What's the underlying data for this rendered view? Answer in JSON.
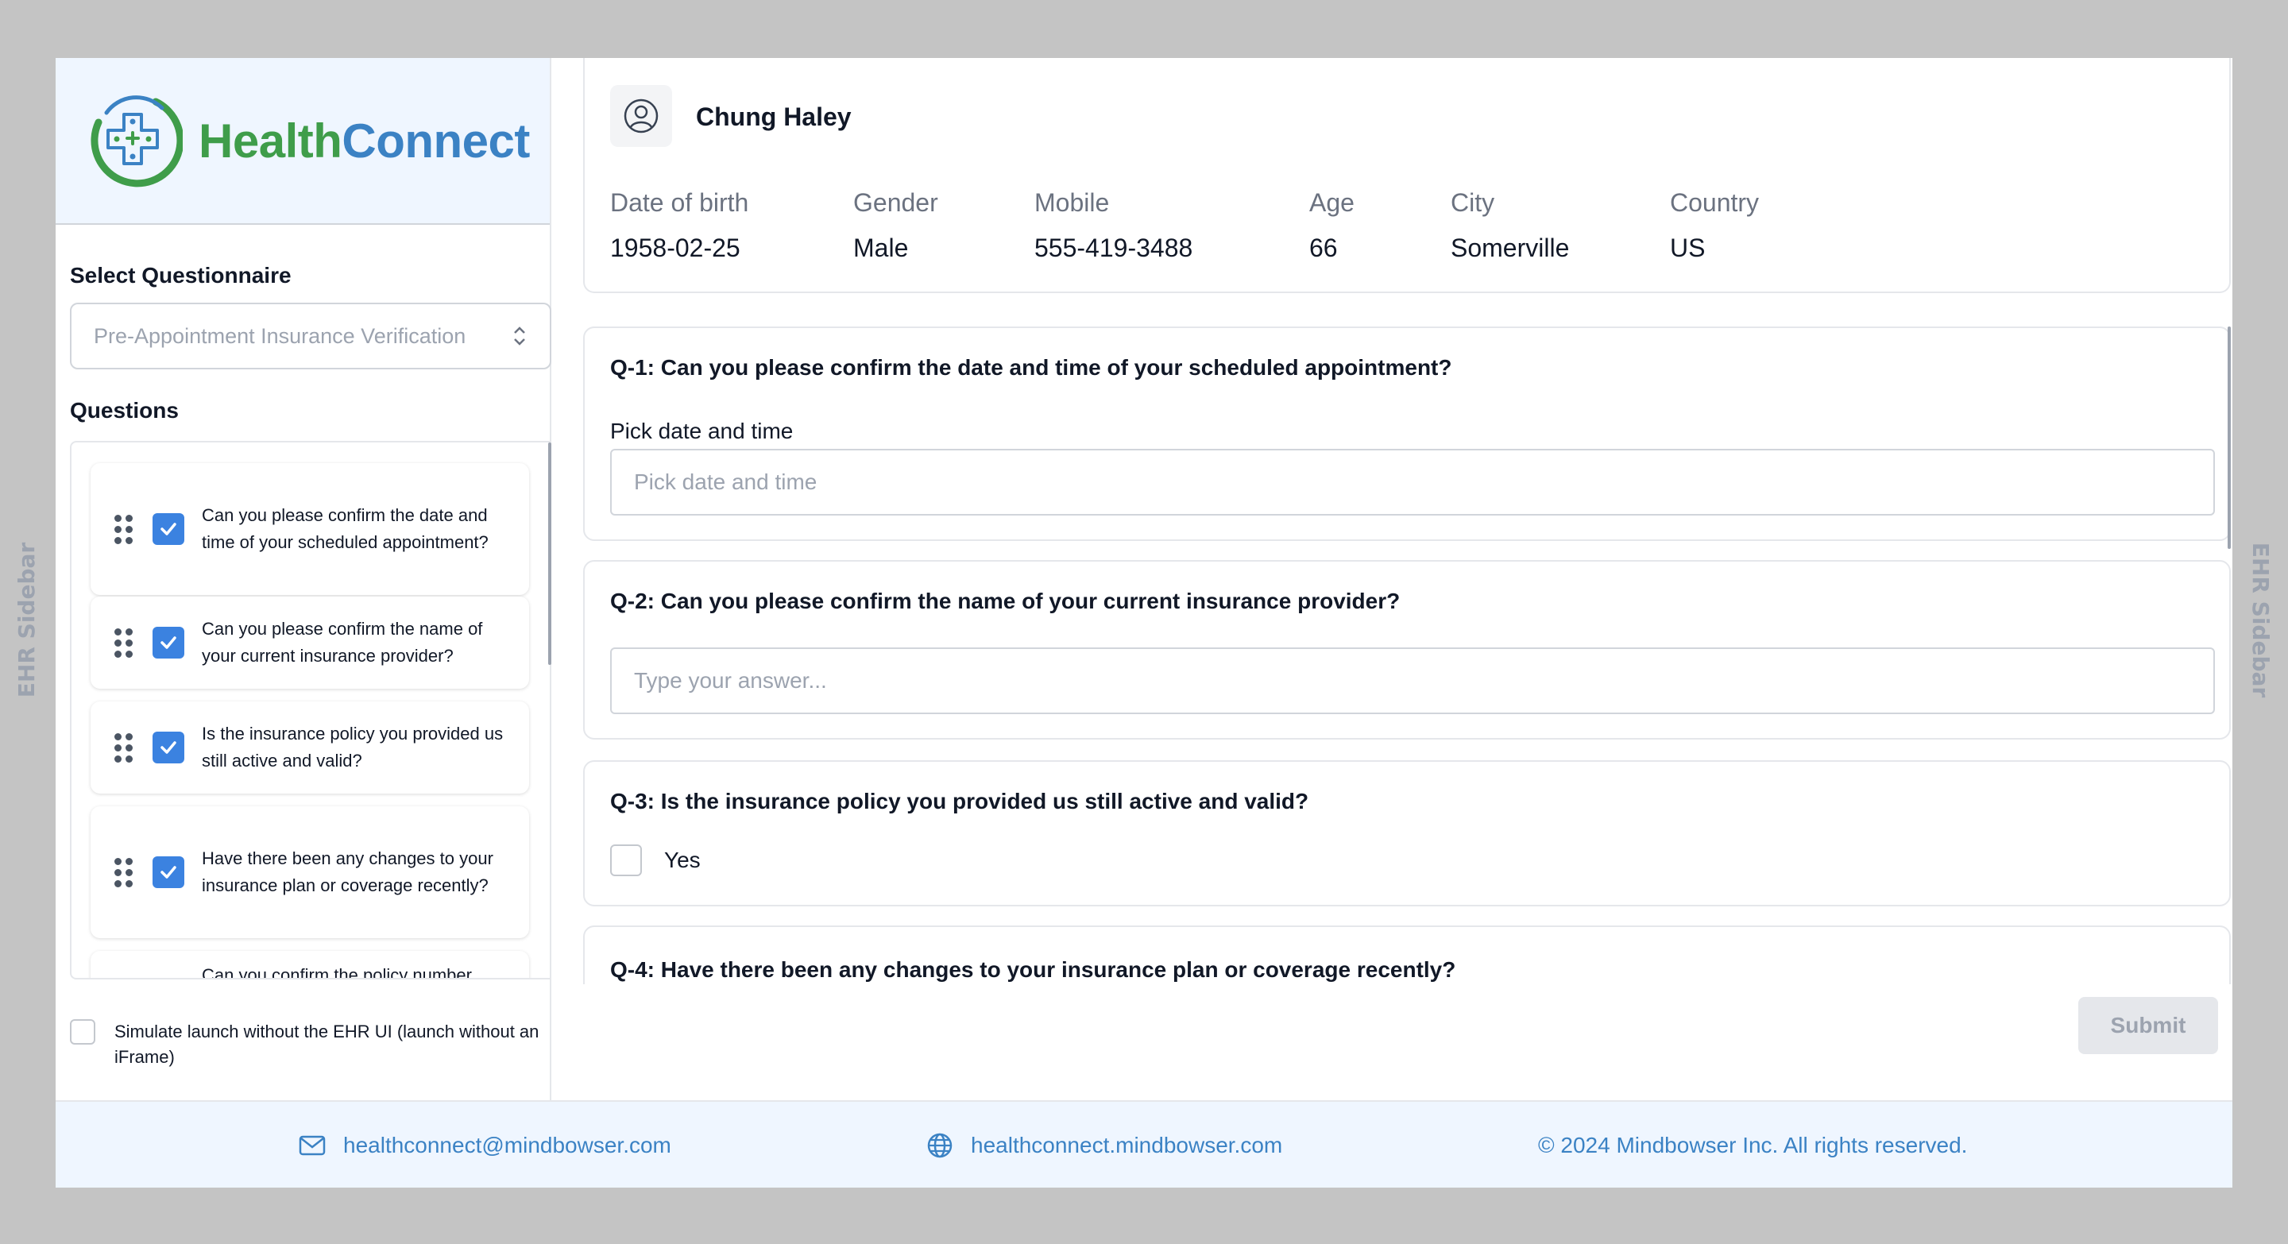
{
  "ehr_sidebar_label": "EHR Sidebar",
  "brand": {
    "name_part1": "Health",
    "name_part2": "Connect",
    "color_green": "#3f9d4a",
    "color_blue": "#3b82c4"
  },
  "sidebar": {
    "select_title": "Select Questionnaire",
    "selected_questionnaire": "Pre-Appointment Insurance Verification",
    "questions_title": "Questions",
    "questions": [
      {
        "label": "Can you please confirm the date and time of your scheduled appointment?",
        "checked": true
      },
      {
        "label": "Can you please confirm the name of your current insurance provider?",
        "checked": true
      },
      {
        "label": "Is the insurance policy you provided us still active and valid?",
        "checked": true
      },
      {
        "label": "Have there been any changes to your insurance plan or coverage recently?",
        "checked": true
      },
      {
        "label": "Can you confirm the policy number",
        "checked": true
      }
    ],
    "simulate_label": "Simulate launch without the EHR UI (launch without an iFrame)"
  },
  "patient": {
    "name": "Chung Haley",
    "fields": [
      {
        "label": "Date of birth",
        "value": "1958-02-25"
      },
      {
        "label": "Gender",
        "value": "Male"
      },
      {
        "label": "Mobile",
        "value": "555-419-3488"
      },
      {
        "label": "Age",
        "value": "66"
      },
      {
        "label": "City",
        "value": "Somerville"
      },
      {
        "label": "Country",
        "value": "US"
      }
    ]
  },
  "questionnaire": {
    "q1": {
      "title": "Q-1: Can you please confirm the date and time of your scheduled appointment?",
      "field_label": "Pick date and time",
      "placeholder": "Pick date and time"
    },
    "q2": {
      "title": "Q-2: Can you please confirm the name of your current insurance provider?",
      "placeholder": "Type your answer..."
    },
    "q3": {
      "title": "Q-3: Is the insurance policy you provided us still active and valid?",
      "option": "Yes"
    },
    "q4": {
      "title": "Q-4: Have there been any changes to your insurance plan or coverage recently?"
    },
    "submit_label": "Submit"
  },
  "footer": {
    "email": "healthconnect@mindbowser.com",
    "website": "healthconnect.mindbowser.com",
    "copyright": "© 2024 Mindbowser Inc. All rights reserved."
  }
}
